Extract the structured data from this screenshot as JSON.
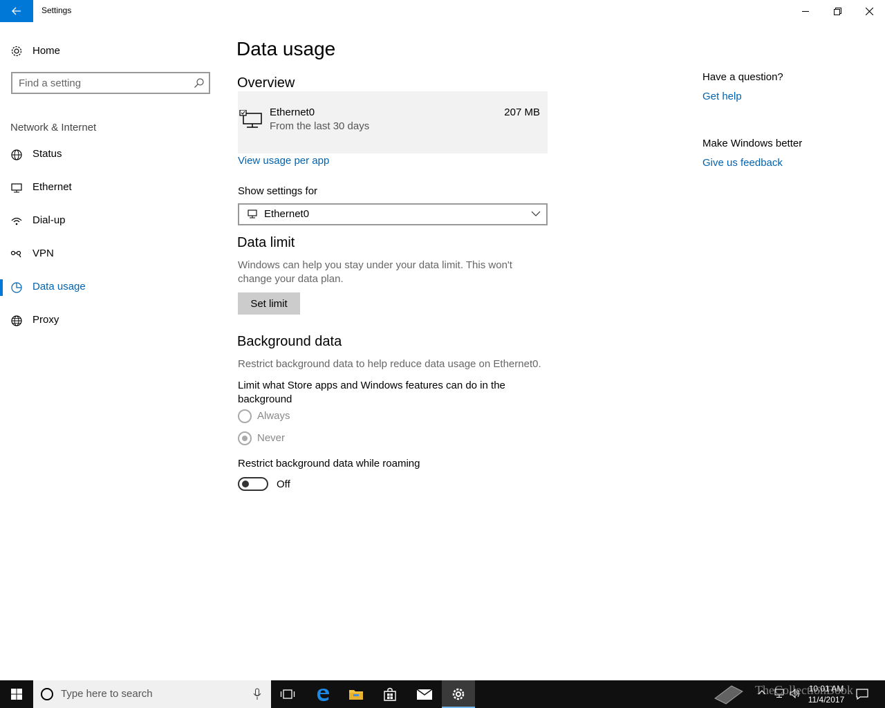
{
  "window": {
    "title": "Settings"
  },
  "sidebar": {
    "home_label": "Home",
    "search_placeholder": "Find a setting",
    "group_title": "Network & Internet",
    "items": [
      {
        "label": "Status",
        "icon": "globe-status-icon"
      },
      {
        "label": "Ethernet",
        "icon": "ethernet-icon"
      },
      {
        "label": "Dial-up",
        "icon": "dialup-icon"
      },
      {
        "label": "VPN",
        "icon": "vpn-icon"
      },
      {
        "label": "Data usage",
        "icon": "data-usage-icon",
        "active": true
      },
      {
        "label": "Proxy",
        "icon": "globe-icon"
      }
    ]
  },
  "main": {
    "title": "Data usage",
    "overview": {
      "heading": "Overview",
      "connection_name": "Ethernet0",
      "period": "From the last 30 days",
      "amount": "207 MB",
      "view_link": "View usage per app"
    },
    "show_settings": {
      "label": "Show settings for",
      "selected": "Ethernet0"
    },
    "data_limit": {
      "heading": "Data limit",
      "description_line1": "Windows can help you stay under your data limit. This won't",
      "description_line2": "change your data plan.",
      "button_label": "Set limit"
    },
    "background_data": {
      "heading": "Background data",
      "description": "Restrict background data to help reduce data usage on Ethernet0.",
      "limit_label_line1": "Limit what Store apps and Windows features can do in the",
      "limit_label_line2": "background",
      "options": [
        {
          "label": "Always",
          "selected": false
        },
        {
          "label": "Never",
          "selected": true
        }
      ],
      "roaming_label": "Restrict background data while roaming",
      "roaming_state": "Off"
    }
  },
  "right_column": {
    "question_title": "Have a question?",
    "help_link": "Get help",
    "better_title": "Make Windows better",
    "feedback_link": "Give us feedback"
  },
  "taskbar": {
    "search_placeholder": "Type here to search",
    "time": "10:01 AM",
    "date": "11/4/2017",
    "watermark": "TheCollectionBook"
  },
  "colors": {
    "accent": "#0078d7",
    "link": "#0063b1",
    "taskbar": "#101010"
  }
}
